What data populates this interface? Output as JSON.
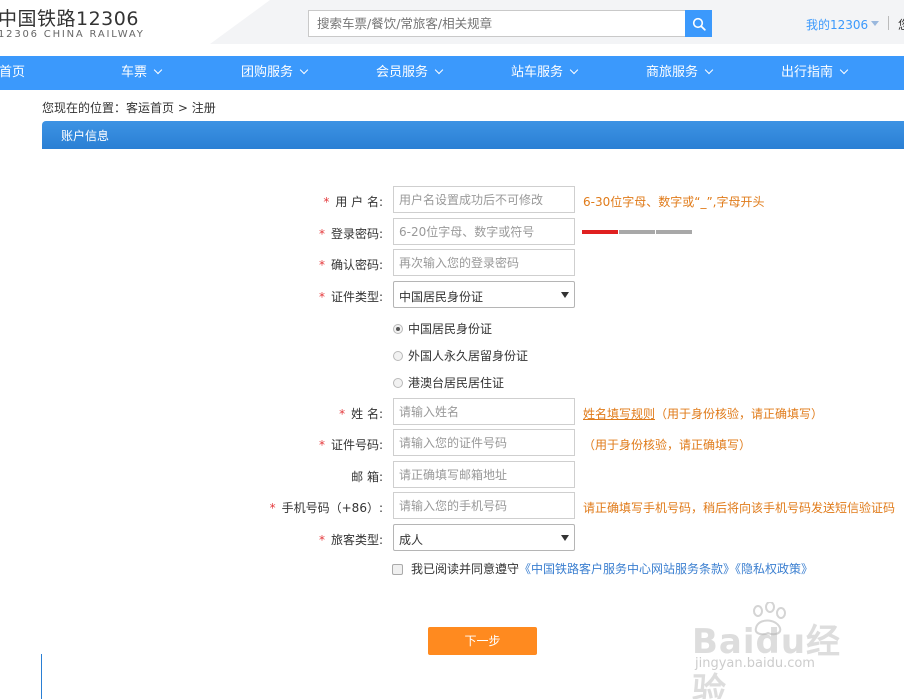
{
  "header": {
    "logo_title": "中国铁路12306",
    "logo_sub": "12306 CHINA RAILWAY",
    "search_placeholder": "搜索车票/餐饮/常旅客/相关规章",
    "my12306": "我的12306",
    "cut_text": "您"
  },
  "nav": {
    "items": [
      {
        "label": "首页"
      },
      {
        "label": "车票"
      },
      {
        "label": "团购服务"
      },
      {
        "label": "会员服务"
      },
      {
        "label": "站车服务"
      },
      {
        "label": "商旅服务"
      },
      {
        "label": "出行指南"
      }
    ]
  },
  "breadcrumb": {
    "prefix": "您现在的位置：",
    "home": "客运首页",
    "sep": " > ",
    "current": "注册"
  },
  "section": {
    "title": "账户信息"
  },
  "form": {
    "required_mark": "*",
    "username": {
      "label": "用 户 名:",
      "placeholder": "用户名设置成功后不可修改",
      "hint": "6-30位字母、数字或“_”,字母开头"
    },
    "password": {
      "label": "登录密码:",
      "placeholder": "6-20位字母、数字或符号"
    },
    "password_strength": {
      "level": 1,
      "max": 3,
      "colors": {
        "active": "#e02020",
        "inactive": "#a8a8a8"
      }
    },
    "confirm": {
      "label": "确认密码:",
      "placeholder": "再次输入您的登录密码"
    },
    "id_type": {
      "label": "证件类型:",
      "value": "中国居民身份证"
    },
    "id_options": [
      {
        "label": "中国居民身份证",
        "checked": true
      },
      {
        "label": "外国人永久居留身份证",
        "checked": false
      },
      {
        "label": "港澳台居民居住证",
        "checked": false
      }
    ],
    "name": {
      "label": "姓 名:",
      "placeholder": "请输入姓名",
      "hint_link": "姓名填写规则",
      "hint": "（用于身份核验，请正确填写）"
    },
    "id_number": {
      "label": "证件号码:",
      "placeholder": "请输入您的证件号码",
      "hint": "（用于身份核验，请正确填写）"
    },
    "email": {
      "label": "邮 箱:",
      "placeholder": "请正确填写邮箱地址"
    },
    "phone": {
      "label": "手机号码（+86）:",
      "placeholder": "请输入您的手机号码",
      "hint": "请正确填写手机号码，稍后将向该手机号码发送短信验证码"
    },
    "passenger_type": {
      "label": "旅客类型:",
      "value": "成人"
    },
    "agree": {
      "text": "我已阅读并同意遵守",
      "link1": "《中国铁路客户服务中心网站服务条款》",
      "link2": "《隐私权政策》"
    },
    "next_button": "下一步"
  },
  "watermark": {
    "text": "Baidu经验",
    "sub": "jingyan.baidu.com"
  },
  "colors": {
    "brand_blue": "#3b99fc",
    "orange": "#ff8a1f",
    "hint": "#e07b1a",
    "required": "#e4393c"
  }
}
